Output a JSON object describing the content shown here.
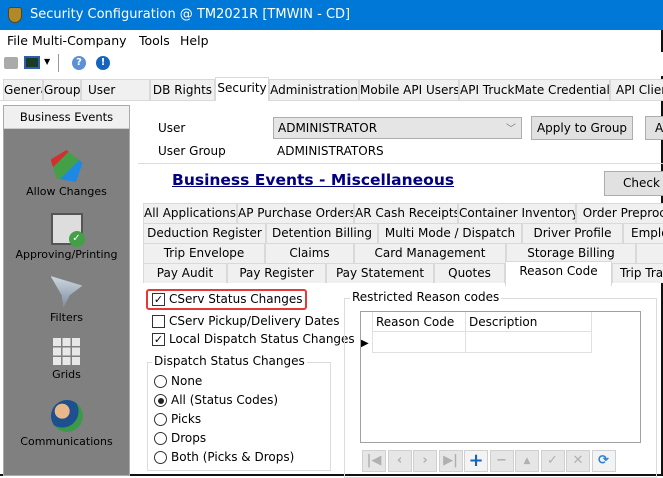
{
  "window": {
    "title": "Security Configuration @ TM2021R [TMWIN - CD]"
  },
  "menu": [
    "File",
    "Multi-Company",
    "Tools",
    "Help"
  ],
  "toolbar": {
    "icons": [
      "printer-icon",
      "monitor-icon",
      "dropdown-icon",
      "help-icon",
      "info-icon"
    ]
  },
  "tabs": {
    "items": [
      "General",
      "Group",
      "User",
      "DB Rights",
      "Security",
      "Administration",
      "Mobile API Users",
      "API TruckMate Credentials",
      "API Clien"
    ],
    "selected": "Security"
  },
  "sidebar": {
    "header": "Business Events",
    "items": [
      {
        "label": "Allow Changes",
        "icon": "allow-changes-icon"
      },
      {
        "label": "Approving/Printing",
        "icon": "printer-check-icon"
      },
      {
        "label": "Filters",
        "icon": "funnel-icon"
      },
      {
        "label": "Grids",
        "icon": "grid-icon"
      },
      {
        "label": "Communications",
        "icon": "user-globe-icon"
      }
    ]
  },
  "user": {
    "label": "User",
    "value": "ADMINISTRATOR",
    "apply_button": "Apply to Group",
    "extra_button": "A",
    "group_label": "User Group",
    "group_value": "ADMINISTRATORS"
  },
  "section": {
    "title": "Business Events - Miscellaneous",
    "check_all": "Check A"
  },
  "subtabs": {
    "rows": [
      [
        "All Applications",
        "AP Purchase Orders",
        "AR Cash Receipts",
        "Container Inventory",
        "Order Preproce"
      ],
      [
        "Deduction Register",
        "Detention Billing",
        "Multi Mode / Dispatch",
        "Driver Profile",
        "Emplo"
      ],
      [
        "Trip Envelope",
        "Claims",
        "Card Management",
        "Storage Billing",
        ""
      ],
      [
        "Pay Audit",
        "Pay Register",
        "Pay Statement",
        "Quotes",
        "Reason Code",
        "Trip Tra"
      ]
    ],
    "selected": "Reason Code"
  },
  "options": {
    "checkboxes": [
      {
        "label": "CServ Status Changes",
        "checked": true,
        "highlighted": true
      },
      {
        "label": "CServ Pickup/Delivery Dates",
        "checked": false
      },
      {
        "label": "Local Dispatch Status Changes",
        "checked": true
      }
    ],
    "dispatch": {
      "title": "Dispatch Status Changes",
      "radios": [
        "None",
        "All (Status Codes)",
        "Picks",
        "Drops",
        "Both (Picks & Drops)"
      ],
      "selected": "All (Status Codes)"
    }
  },
  "restricted": {
    "title": "Restricted Reason codes",
    "columns": [
      "Reason Code",
      "Description"
    ],
    "rows": [],
    "nav": [
      "first-icon",
      "prev-icon",
      "next-icon",
      "last-icon",
      "add-icon",
      "delete-icon",
      "up-icon",
      "post-icon",
      "cancel-icon",
      "refresh-icon"
    ]
  },
  "colors": {
    "titlebar": "#0078d7",
    "sidebar": "#808080",
    "highlight": "#e53935",
    "link": "#000080"
  }
}
